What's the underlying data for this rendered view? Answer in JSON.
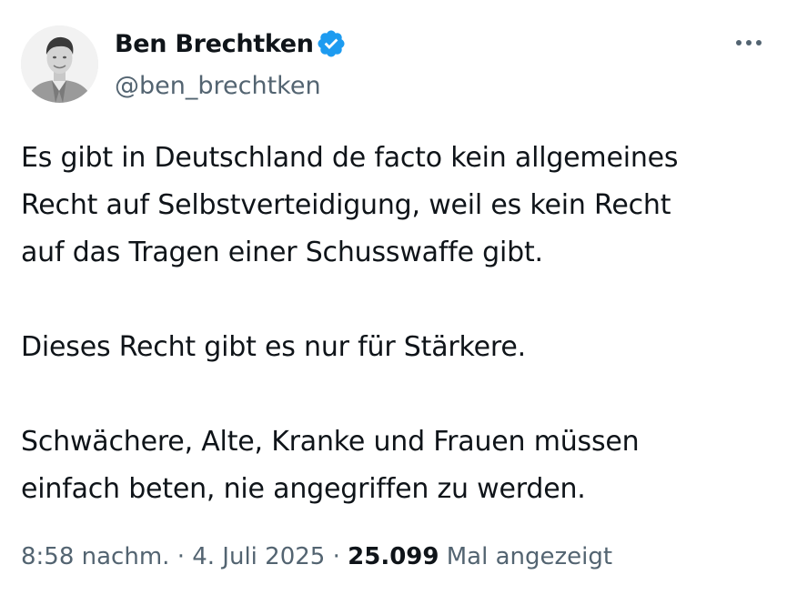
{
  "author": {
    "display_name": "Ben Brechtken",
    "handle": "@ben_brechtken",
    "verified": true,
    "verified_color": "#1d9bf0"
  },
  "tweet": {
    "paragraphs": [
      [
        "Es gibt in Deutschland de facto kein allgemeines",
        "Recht auf Selbstverteidigung, weil es kein Recht",
        "auf das Tragen einer Schusswaffe gibt."
      ],
      [
        "Dieses Recht gibt es nur für Stärkere."
      ],
      [
        "Schwächere, Alte, Kranke und Frauen müssen",
        "einfach beten, nie angegriffen zu werden."
      ]
    ]
  },
  "meta": {
    "time": "8:58 nachm.",
    "separator": " · ",
    "date": "4. Juli 2025",
    "views_count": "25.099",
    "views_label": "Mal angezeigt"
  },
  "icons": {
    "avatar": "profile-photo",
    "verified": "verified-badge-icon",
    "more": "more-horizontal-icon"
  },
  "colors": {
    "text_primary": "#0f1419",
    "text_secondary": "#536471",
    "accent": "#1d9bf0"
  }
}
